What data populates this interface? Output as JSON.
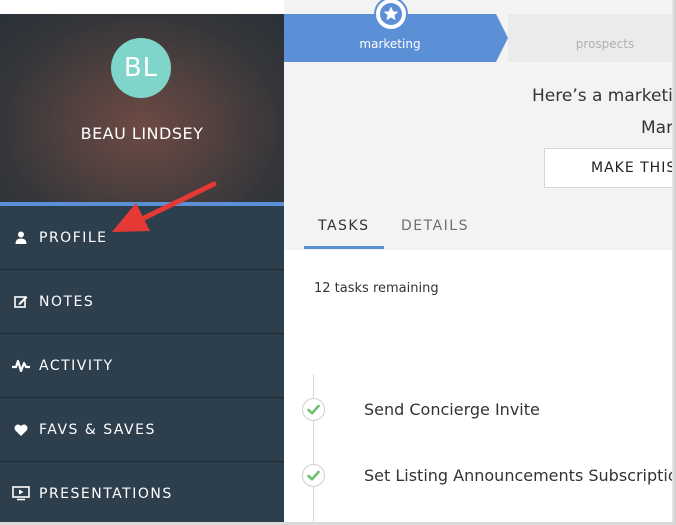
{
  "sidebar": {
    "avatar_initials": "BL",
    "user_name": "BEAU LINDSEY",
    "items": [
      {
        "label": "PROFILE",
        "icon": "user-icon"
      },
      {
        "label": "NOTES",
        "icon": "edit-icon"
      },
      {
        "label": "ACTIVITY",
        "icon": "pulse-icon"
      },
      {
        "label": "FAVS & SAVES",
        "icon": "heart-icon"
      },
      {
        "label": "PRESENTATIONS",
        "icon": "presentation-icon"
      }
    ]
  },
  "pipeline": {
    "active_stage": "marketing",
    "next_stage": "prospects",
    "active_icon": "star-icon"
  },
  "header": {
    "intro_text": "Here’s a marketin",
    "intro_name": "Mar",
    "make_button_label": "MAKE THIS"
  },
  "tabs": [
    {
      "label": "TASKS",
      "active": true
    },
    {
      "label": "DETAILS",
      "active": false
    }
  ],
  "tasks": {
    "remaining_text": "12 tasks remaining",
    "items": [
      {
        "label": "Send Concierge Invite",
        "done": true
      },
      {
        "label": "Set Listing Announcements Subscription",
        "done": true
      }
    ]
  },
  "colors": {
    "sidebar_bg": "#2d3e4d",
    "accent": "#5b8fd6",
    "avatar_bg": "#7fd5c9",
    "check_green": "#6cc070",
    "annotation_red": "#e53935"
  }
}
